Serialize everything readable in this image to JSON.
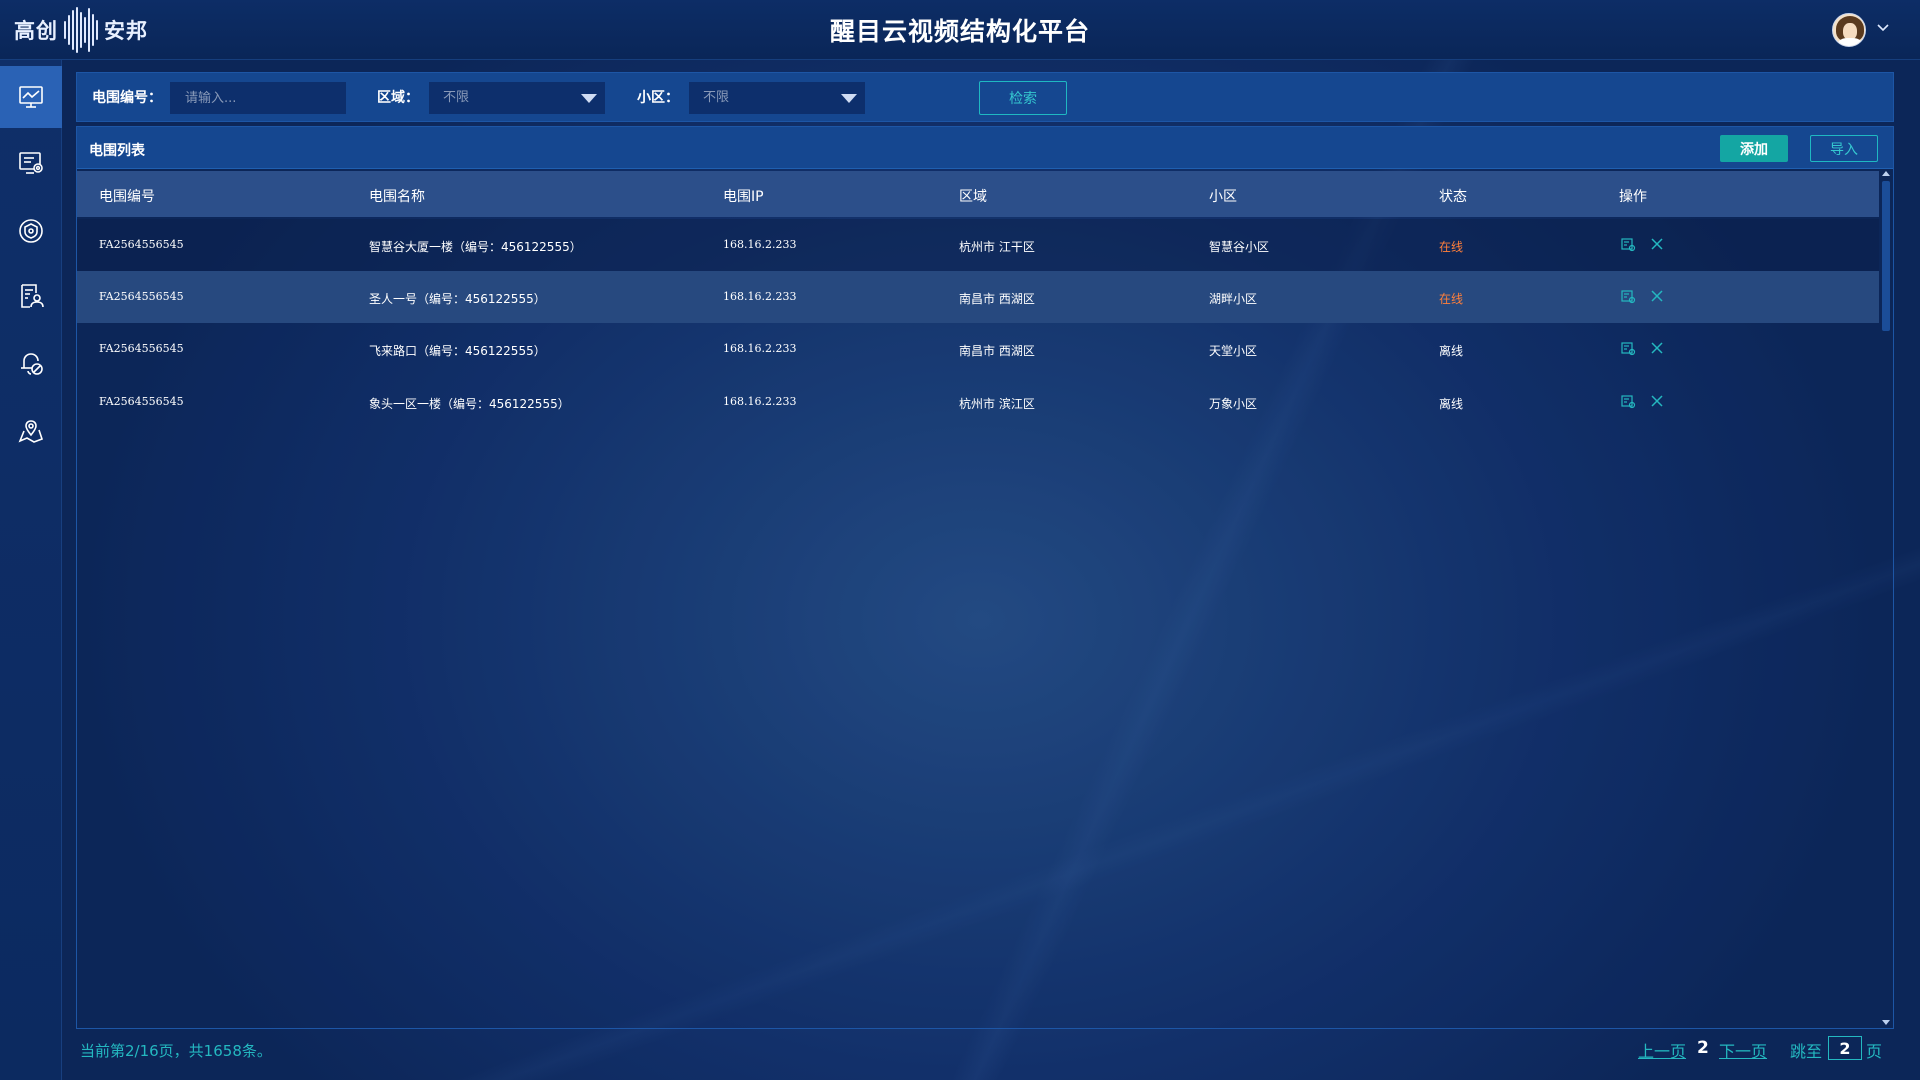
{
  "header": {
    "logo_left": "高创",
    "logo_right": "安邦",
    "title": "醒目云视频结构化平台"
  },
  "sidebar": {
    "items": [
      {
        "icon": "monitor-icon",
        "active": true
      },
      {
        "icon": "device-settings-icon",
        "active": false
      },
      {
        "icon": "shield-icon",
        "active": false
      },
      {
        "icon": "user-document-icon",
        "active": false
      },
      {
        "icon": "alarm-bell-icon",
        "active": false
      },
      {
        "icon": "map-pin-icon",
        "active": false
      }
    ]
  },
  "filters": {
    "fence_id_label": "电围编号：",
    "fence_id_placeholder": "请输入...",
    "region_label": "区域：",
    "region_value": "不限",
    "community_label": "小区：",
    "community_value": "不限",
    "search_label": "检索"
  },
  "panel": {
    "title": "电围列表",
    "add_label": "添加",
    "import_label": "导入"
  },
  "table": {
    "columns": [
      "电围编号",
      "电围名称",
      "电围IP",
      "区域",
      "小区",
      "状态",
      "操作"
    ],
    "rows": [
      {
        "id": "FA2564556545",
        "name": "智慧谷大厦一楼（编号：456122555）",
        "ip": "168.16.2.233",
        "region": "杭州市 江干区",
        "community": "智慧谷小区",
        "status": "在线",
        "online": true
      },
      {
        "id": "FA2564556545",
        "name": "圣人一号（编号：456122555）",
        "ip": "168.16.2.233",
        "region": "南昌市 西湖区",
        "community": "湖畔小区",
        "status": "在线",
        "online": true
      },
      {
        "id": "FA2564556545",
        "name": "飞来路口（编号：456122555）",
        "ip": "168.16.2.233",
        "region": "南昌市 西湖区",
        "community": "天堂小区",
        "status": "离线",
        "online": false
      },
      {
        "id": "FA2564556545",
        "name": "象头一区一楼（编号：456122555）",
        "ip": "168.16.2.233",
        "region": "杭州市 滨江区",
        "community": "万象小区",
        "status": "离线",
        "online": false
      }
    ]
  },
  "pagination": {
    "info": "当前第2/16页，共1658条。",
    "prev_label": "上一页",
    "current_page": "2",
    "next_label": "下一页",
    "jump_label": "跳至",
    "jump_value": "2",
    "page_suffix": "页"
  },
  "colors": {
    "accent": "#24b8c0",
    "online": "#ff7f3a",
    "header_bg": "#0d2d66",
    "active_nav": "#2a62b5"
  }
}
